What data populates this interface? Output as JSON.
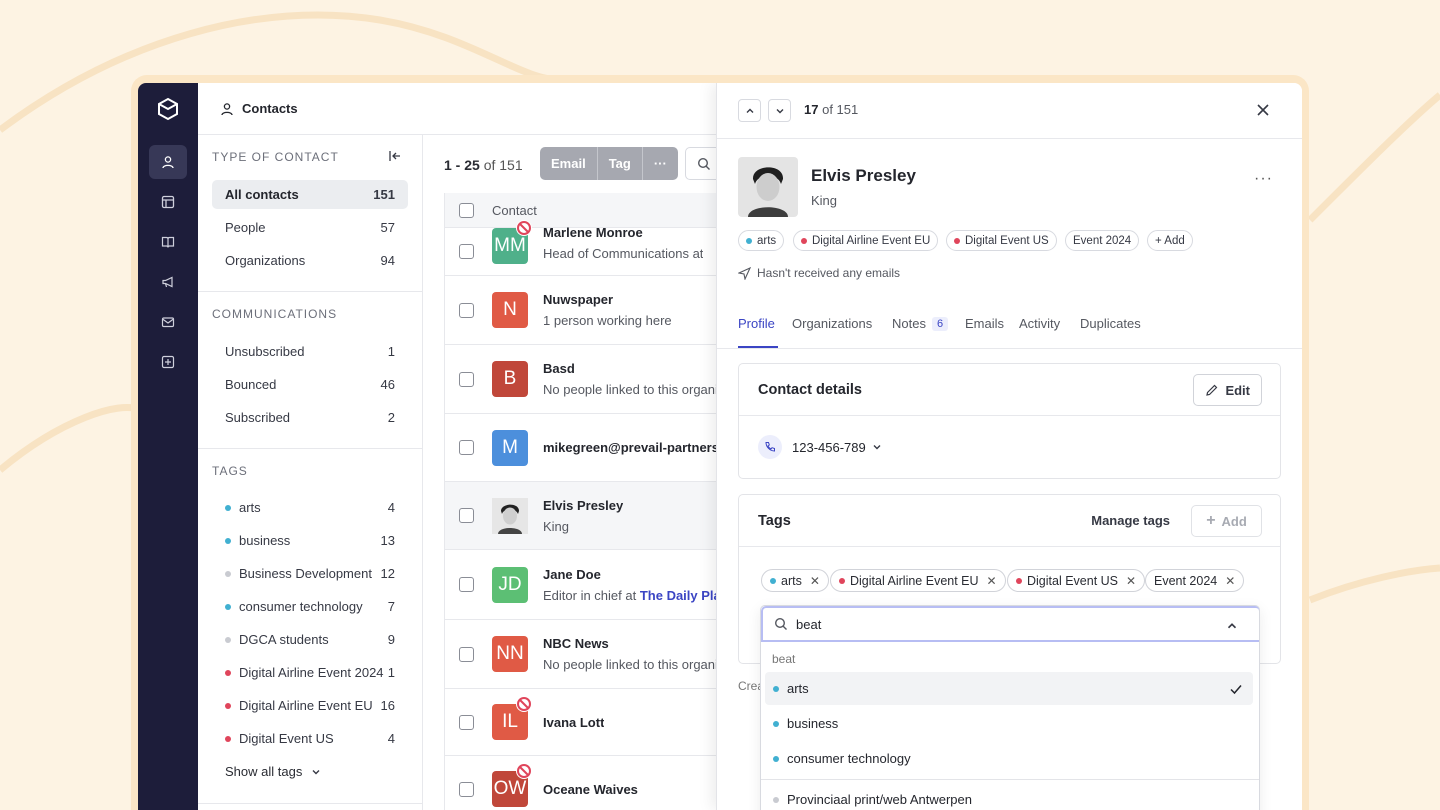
{
  "colors": {
    "accent": "#3b45c4",
    "rail": "#1d1d3a",
    "tag_blue": "#41b0d1",
    "tag_red": "#e0455b",
    "tag_grey": "#c9cbd1",
    "background": "#fdf3e3"
  },
  "topbar": {
    "title": "Contacts"
  },
  "sidebar": {
    "type_title": "TYPE OF CONTACT",
    "types": [
      {
        "label": "All contacts",
        "count": "151"
      },
      {
        "label": "People",
        "count": "57"
      },
      {
        "label": "Organizations",
        "count": "94"
      }
    ],
    "comm_title": "COMMUNICATIONS",
    "comms": [
      {
        "label": "Unsubscribed",
        "count": "1"
      },
      {
        "label": "Bounced",
        "count": "46"
      },
      {
        "label": "Subscribed",
        "count": "2"
      }
    ],
    "tags_title": "TAGS",
    "tags": [
      {
        "label": "arts",
        "count": "4",
        "color": "#41b0d1"
      },
      {
        "label": "business",
        "count": "13",
        "color": "#41b0d1"
      },
      {
        "label": "Business Development",
        "count": "12",
        "color": "#c9cbd1"
      },
      {
        "label": "consumer technology",
        "count": "7",
        "color": "#41b0d1"
      },
      {
        "label": "DGCA students",
        "count": "9",
        "color": "#c9cbd1"
      },
      {
        "label": "Digital Airline Event 2024",
        "count": "1",
        "color": "#e0455b"
      },
      {
        "label": "Digital Airline Event EU",
        "count": "16",
        "color": "#e0455b"
      },
      {
        "label": "Digital Event US",
        "count": "4",
        "color": "#e0455b"
      }
    ],
    "show_all": "Show all tags"
  },
  "list": {
    "range": "1 - 25",
    "of": "of 151",
    "actions": [
      "Email",
      "Tag",
      "···"
    ],
    "col_contact": "Contact",
    "rows": [
      {
        "initials": "MM",
        "color": "#4fb08a",
        "name": "Marlene Monroe",
        "sub": "Head of Communications at",
        "banned": true
      },
      {
        "initials": "N",
        "color": "#e05a45",
        "name": "Nuwspaper",
        "sub": "1 person working here",
        "banned": false
      },
      {
        "initials": "B",
        "color": "#c0473a",
        "name": "Basd",
        "sub": "No people linked to this organization",
        "banned": false
      },
      {
        "initials": "M",
        "color": "#4c8fdc",
        "name": "mikegreen@prevail-partners.com",
        "sub": "",
        "banned": false
      },
      {
        "initials": "",
        "color": "#d9d9d9",
        "name": "Elvis Presley",
        "sub": "King",
        "banned": false,
        "photo": true
      },
      {
        "initials": "JD",
        "color": "#5cbf74",
        "name": "Jane Doe",
        "sub": "Editor in chief at",
        "link": "The Daily Planet",
        "banned": false
      },
      {
        "initials": "NN",
        "color": "#e05a45",
        "name": "NBC News",
        "sub": "No people linked to this organization",
        "banned": false
      },
      {
        "initials": "IL",
        "color": "#e05a45",
        "name": "Ivana Lott",
        "sub": "",
        "banned": true
      },
      {
        "initials": "OW",
        "color": "#c0473a",
        "name": "Oceane Waives",
        "sub": "",
        "banned": true
      }
    ]
  },
  "panel": {
    "position": "17",
    "of": "of 151",
    "name": "Elvis Presley",
    "role": "King",
    "chips": [
      {
        "label": "arts",
        "color": "#41b0d1"
      },
      {
        "label": "Digital Airline Event EU",
        "color": "#e0455b"
      },
      {
        "label": "Digital Event US",
        "color": "#e0455b"
      },
      {
        "label": "Event 2024",
        "color": ""
      },
      {
        "label": "+ Add",
        "color": ""
      }
    ],
    "no_emails": "Hasn't received any emails",
    "tabs": [
      {
        "label": "Profile"
      },
      {
        "label": "Organizations"
      },
      {
        "label": "Notes",
        "badge": "6"
      },
      {
        "label": "Emails"
      },
      {
        "label": "Activity"
      },
      {
        "label": "Duplicates"
      }
    ],
    "contact_details": {
      "title": "Contact details",
      "edit": "Edit",
      "phone": "123-456-789"
    },
    "tags_card": {
      "title": "Tags",
      "manage": "Manage tags",
      "add": "Add",
      "tags": [
        {
          "label": "arts",
          "color": "#41b0d1"
        },
        {
          "label": "Digital Airline Event EU",
          "color": "#e0455b"
        },
        {
          "label": "Digital Event US",
          "color": "#e0455b"
        },
        {
          "label": "Event 2024",
          "color": ""
        }
      ]
    },
    "created_prefix": "Crea",
    "dropdown": {
      "value": "beat",
      "hint": "beat",
      "options": [
        {
          "label": "arts",
          "color": "#41b0d1",
          "checked": true
        },
        {
          "label": "business",
          "color": "#41b0d1"
        },
        {
          "label": "consumer technology",
          "color": "#41b0d1"
        },
        {
          "label": "Provinciaal print/web Antwerpen",
          "color": "#c9cbd1"
        }
      ]
    }
  }
}
